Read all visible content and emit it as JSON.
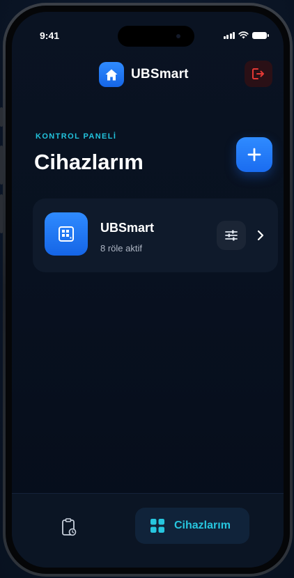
{
  "status_bar": {
    "time": "9:41"
  },
  "header": {
    "app_name": "UBSmart",
    "home_icon": "home-icon",
    "logout_icon": "logout-icon"
  },
  "dashboard": {
    "eyebrow": "KONTROL PANELİ",
    "title": "Cihazlarım",
    "add_icon": "plus-icon"
  },
  "devices": [
    {
      "name": "UBSmart",
      "status": "8 röle aktif",
      "icon": "device-chip-icon"
    }
  ],
  "tabbar": {
    "tabs": [
      {
        "icon": "clipboard-icon",
        "active": false
      },
      {
        "label": "Cihazlarım",
        "icon": "grid-icon",
        "active": true
      }
    ]
  },
  "colors": {
    "accent": "#2f8bff",
    "accent_cyan": "#27c6df",
    "logout_red": "#e53935",
    "background": "#081120",
    "card": "#0f1a2b"
  }
}
